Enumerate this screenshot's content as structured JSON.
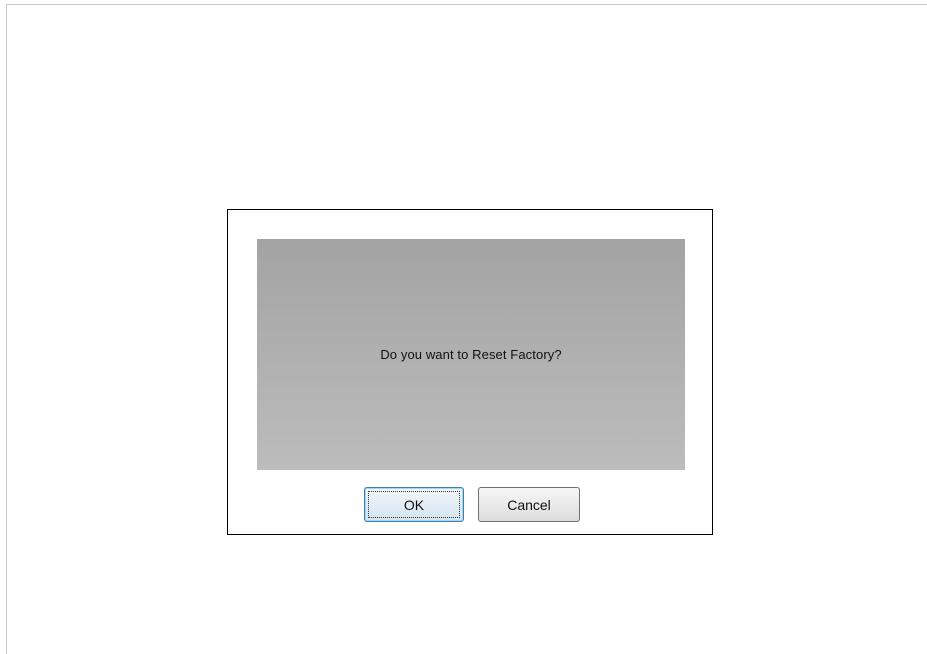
{
  "dialog": {
    "message": "Do you want to Reset Factory?",
    "ok_label": "OK",
    "cancel_label": "Cancel",
    "focused_button": "OK"
  }
}
